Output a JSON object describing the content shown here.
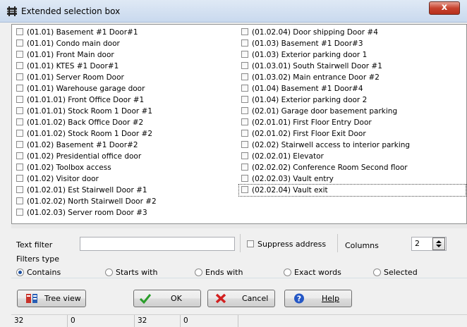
{
  "window": {
    "title": "Extended selection box",
    "close_label": "x"
  },
  "list": {
    "column1": [
      "(01.01) Basement #1 Door#1",
      "(01.01) Condo main door",
      "(01.01) Front Main door",
      "(01.01) KTES #1 Door#1",
      "(01.01) Server Room Door",
      "(01.01) Warehouse garage door",
      "(01.01.01) Front Office Door #1",
      "(01.01.01) Stock Room 1 Door #1",
      "(01.01.02) Back Office Door #2",
      "(01.01.02) Stock Room 1 Door #2",
      "(01.02) Basement #1 Door#2",
      "(01.02) Presidential office door",
      "(01.02) Toolbox access",
      "(01.02) Visitor door",
      "(01.02.01) Est Stairwell Door #1",
      "(01.02.02) North Stairwell Door #2",
      "(01.02.03) Server room Door #3"
    ],
    "column2": [
      "(01.02.04) Door shipping Door #4",
      "(01.03) Basement #1 Door#3",
      "(01.03) Exterior parking door 1",
      "(01.03.01) South Stairwell Door #1",
      "(01.03.02) Main entrance Door #2",
      "(01.04) Basement #1 Door#4",
      "(01.04) Exterior parking door 2",
      "(02.01) Garage door basement parking",
      "(02.01.01) First Floor Entry Door",
      "(02.01.02) First Floor Exit Door",
      "(02.02) Stairwell access to interior parking",
      "(02.02.01) Elevator",
      "(02.02.02) Conference Room Second floor",
      "(02.02.03) Vault entry",
      "(02.02.04) Vault exit"
    ]
  },
  "filter": {
    "label": "Text filter",
    "value": "",
    "suppress_label": "Suppress address",
    "columns_label": "Columns",
    "columns_value": "2"
  },
  "filters_type": {
    "label": "Filters type",
    "options": [
      "Contains",
      "Starts with",
      "Ends with",
      "Exact words",
      "Selected"
    ],
    "selected": "Contains"
  },
  "buttons": {
    "tree_view": "Tree view",
    "ok": "OK",
    "cancel": "Cancel",
    "help": "Help"
  },
  "status": [
    "32",
    "0",
    "32",
    "0"
  ],
  "colors": {
    "ok_check": "#2a9d2a",
    "cancel_x": "#d22020",
    "help_icon": "#2457c5"
  }
}
